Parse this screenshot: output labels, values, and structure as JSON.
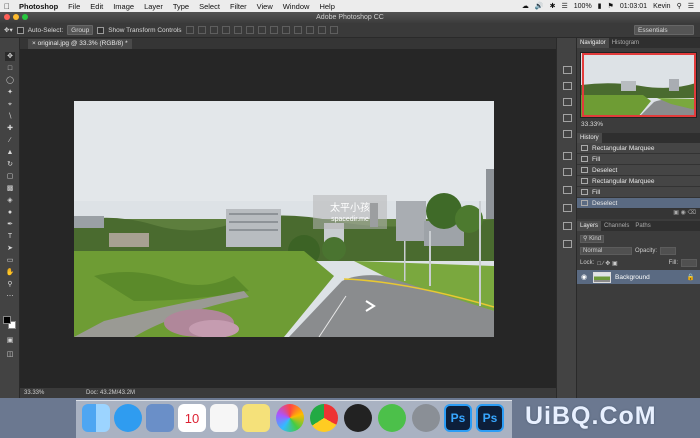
{
  "menubar": {
    "app": "Photoshop",
    "items": [
      "File",
      "Edit",
      "Image",
      "Layer",
      "Type",
      "Select",
      "Filter",
      "View",
      "Window",
      "Help"
    ],
    "battery": "100%",
    "clock": "01:03:01",
    "user": "Kevin"
  },
  "window": {
    "title": "Adobe Photoshop CC"
  },
  "options": {
    "auto_select_label": "Auto-Select:",
    "auto_select_value": "Group",
    "transform_label": "Show Transform Controls",
    "workspace": "Essentials"
  },
  "document": {
    "tab_label": "original.jpg @ 33.3% (RGB/8) *",
    "zoom": "33.33%",
    "doc_size": "Doc: 43.2M/43.2M"
  },
  "watermark": {
    "line1": "太平小孩",
    "line2": "spacedir.me"
  },
  "panels": {
    "navigator_tab": "Navigator",
    "histogram_tab": "Histogram",
    "nav_zoom": "33.33%",
    "history_tab": "History",
    "history_items": [
      {
        "label": "Rectangular Marquee"
      },
      {
        "label": "Fill"
      },
      {
        "label": "Deselect"
      },
      {
        "label": "Rectangular Marquee"
      },
      {
        "label": "Fill"
      },
      {
        "label": "Deselect"
      }
    ],
    "layers_tab": "Layers",
    "channels_tab": "Channels",
    "paths_tab": "Paths",
    "kind_label": "Kind",
    "blend_mode": "Normal",
    "opacity_label": "Opacity:",
    "lock_label": "Lock:",
    "fill_label": "Fill:",
    "layer_name": "Background"
  },
  "watermark_site": "UiBQ.CoM",
  "colors": {
    "ps_blue": "#2c9df5",
    "selection": "#5a6a82",
    "nav_frame": "#e23b3b"
  }
}
